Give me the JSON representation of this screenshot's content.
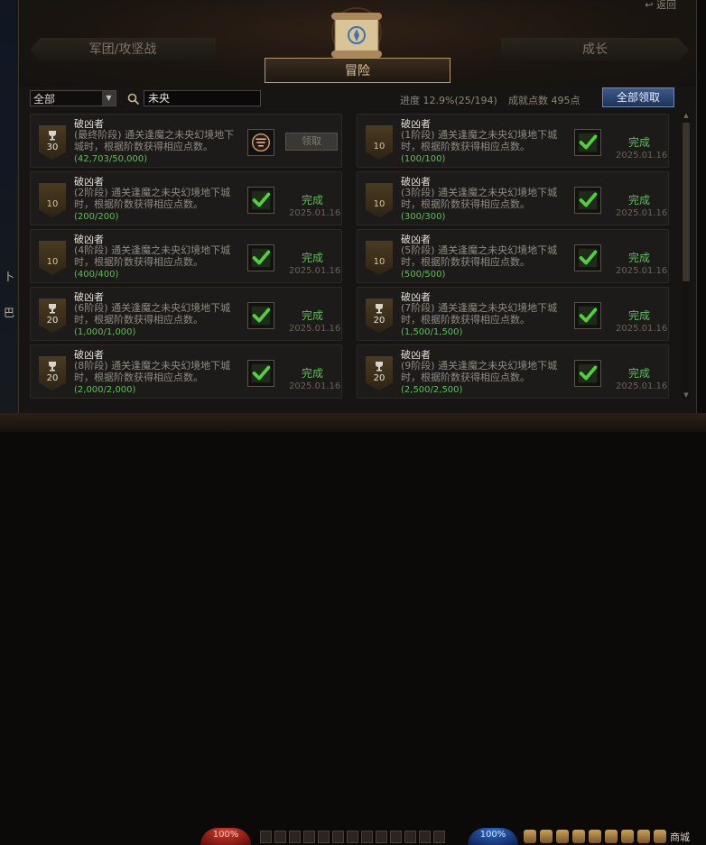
{
  "header": {
    "back_label": "返回",
    "tabs": [
      {
        "label": "军团/攻坚战"
      },
      {
        "label": "冒险"
      },
      {
        "label": "成长"
      }
    ]
  },
  "toolbar": {
    "filter_value": "全部",
    "search_value": "未央",
    "progress_label": "进度",
    "progress_percent": "12.9%",
    "progress_count": "(25/194)",
    "points_label": "成就点数",
    "points_value": "495点",
    "claim_all_label": "全部领取"
  },
  "achievements": [
    {
      "title": "破凶者",
      "stage": "(最终阶段)",
      "desc": "通关逢魔之未央幻境地下城时，根据阶数获得相应点数。",
      "count": "(42,703/50,000)",
      "badge": "30",
      "badge_style": "cup",
      "state": "claim",
      "claim_label": "领取",
      "done_label": "",
      "date": ""
    },
    {
      "title": "破凶者",
      "stage": "(1阶段)",
      "desc": "通关逢魔之未央幻境地下城时，根据阶数获得相应点数。",
      "count": "(100/100)",
      "badge": "10",
      "badge_style": "plain",
      "state": "done",
      "claim_label": "",
      "done_label": "完成",
      "date": "2025.01.16"
    },
    {
      "title": "破凶者",
      "stage": "(2阶段)",
      "desc": "通关逢魔之未央幻境地下城时，根据阶数获得相应点数。",
      "count": "(200/200)",
      "badge": "10",
      "badge_style": "plain",
      "state": "done",
      "claim_label": "",
      "done_label": "完成",
      "date": "2025.01.16"
    },
    {
      "title": "破凶者",
      "stage": "(3阶段)",
      "desc": "通关逢魔之未央幻境地下城时，根据阶数获得相应点数。",
      "count": "(300/300)",
      "badge": "10",
      "badge_style": "plain",
      "state": "done",
      "claim_label": "",
      "done_label": "完成",
      "date": "2025.01.16"
    },
    {
      "title": "破凶者",
      "stage": "(4阶段)",
      "desc": "通关逢魔之未央幻境地下城时，根据阶数获得相应点数。",
      "count": "(400/400)",
      "badge": "10",
      "badge_style": "plain",
      "state": "done",
      "claim_label": "",
      "done_label": "完成",
      "date": "2025.01.16"
    },
    {
      "title": "破凶者",
      "stage": "(5阶段)",
      "desc": "通关逢魔之未央幻境地下城时，根据阶数获得相应点数。",
      "count": "(500/500)",
      "badge": "10",
      "badge_style": "plain",
      "state": "done",
      "claim_label": "",
      "done_label": "完成",
      "date": "2025.01.16"
    },
    {
      "title": "破凶者",
      "stage": "(6阶段)",
      "desc": "通关逢魔之未央幻境地下城时，根据阶数获得相应点数。",
      "count": "(1,000/1,000)",
      "badge": "20",
      "badge_style": "cup",
      "state": "done",
      "claim_label": "",
      "done_label": "完成",
      "date": "2025.01.16"
    },
    {
      "title": "破凶者",
      "stage": "(7阶段)",
      "desc": "通关逢魔之未央幻境地下城时，根据阶数获得相应点数。",
      "count": "(1,500/1,500)",
      "badge": "20",
      "badge_style": "cup",
      "state": "done",
      "claim_label": "",
      "done_label": "完成",
      "date": "2025.01.16"
    },
    {
      "title": "破凶者",
      "stage": "(8阶段)",
      "desc": "通关逢魔之未央幻境地下城时，根据阶数获得相应点数。",
      "count": "(2,000/2,000)",
      "badge": "20",
      "badge_style": "cup",
      "state": "done",
      "claim_label": "",
      "done_label": "完成",
      "date": "2025.01.16"
    },
    {
      "title": "破凶者",
      "stage": "(9阶段)",
      "desc": "通关逢魔之未央幻境地下城时，根据阶数获得相应点数。",
      "count": "(2,500/2,500)",
      "badge": "20",
      "badge_style": "cup",
      "state": "done",
      "claim_label": "",
      "done_label": "完成",
      "date": "2025.01.16"
    }
  ],
  "bottom_bar": {
    "hp_percent": "100%",
    "mp_percent": "100%",
    "shop_label": "商城"
  },
  "colors": {
    "complete_green": "#5fbd5a",
    "accent_gold": "#b99a6a",
    "button_blue": "#2b4a78"
  }
}
